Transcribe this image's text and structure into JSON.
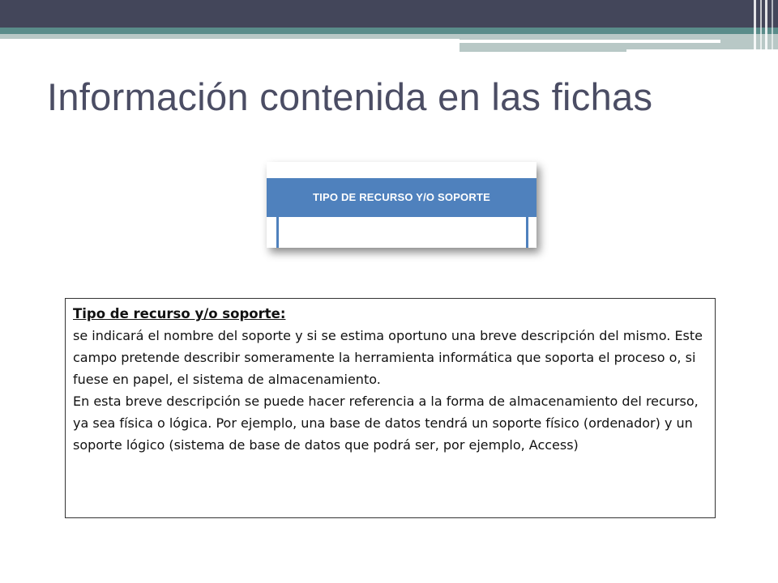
{
  "slide": {
    "title": "Información contenida en las fichas"
  },
  "table_header": {
    "column_label": "TIPO DE RECURSO Y/O SOPORTE",
    "header_color": "#4f81bd"
  },
  "description": {
    "heading": "Tipo de recurso y/o soporte:",
    "paragraph_1": "se indicará el nombre del soporte y si se estima oportuno una breve descripción del mismo. Este campo pretende describir someramente la herramienta informática que soporta el proceso o, si fuese en papel, el sistema de almacenamiento.",
    "paragraph_2": "En esta breve descripción se puede hacer referencia a la forma de almacenamiento del recurso, ya sea física o lógica. Por ejemplo, una base de datos tendrá un soporte físico (ordenador) y un soporte lógico (sistema de base de datos que podrá ser, por ejemplo, Access)"
  },
  "theme": {
    "banner_color": "#43465a",
    "accent_teal": "#5a8c8a",
    "title_color": "#4b4d64"
  }
}
